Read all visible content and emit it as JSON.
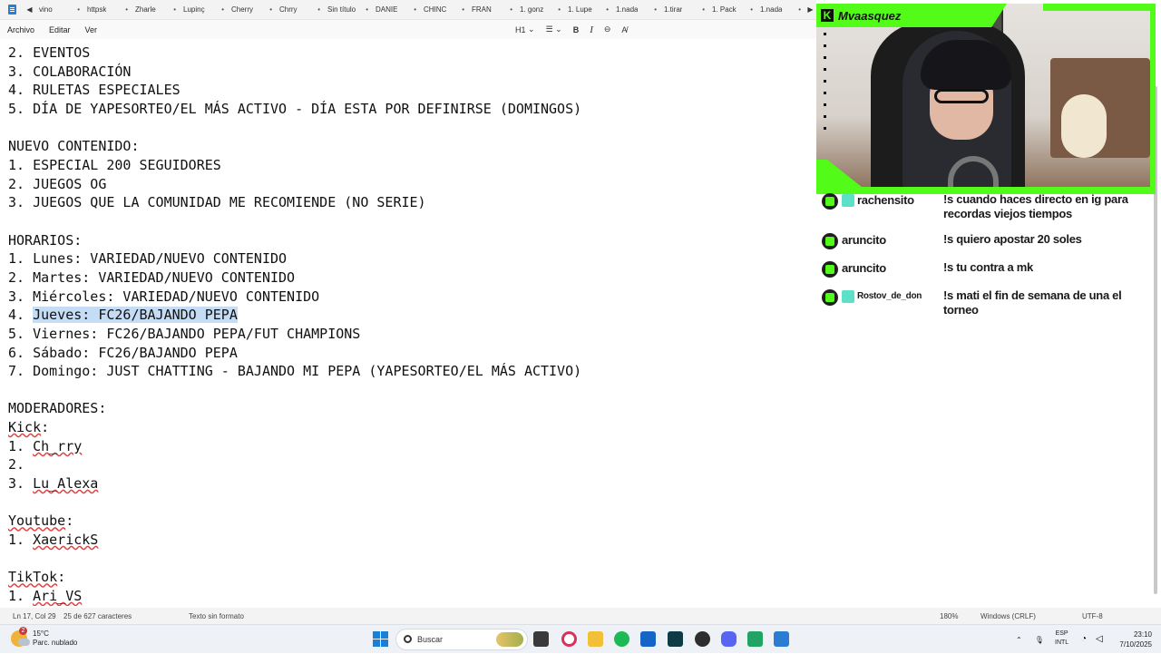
{
  "tabs": [
    "vino",
    "httpsk",
    "Zharle",
    "Lupinç",
    "Cherry",
    "Chrry",
    "Sin título",
    "DANIE",
    "CHINC",
    "FRAN",
    "1. gonz",
    "1. Lupe",
    "1.nada",
    "1.tirar",
    "1. Pack",
    "1.nada"
  ],
  "menu": {
    "file": "Archivo",
    "edit": "Editar",
    "view": "Ver"
  },
  "format": {
    "heading": "H1",
    "bold": "B",
    "italic": "I"
  },
  "document": {
    "lines": [
      "2. EVENTOS",
      "3. COLABORACIÓN",
      "4. RULETAS ESPECIALES",
      "5. DÍA DE YAPESORTEO/EL MÁS ACTIVO - DÍA ESTA POR DEFINIRSE (DOMINGOS)",
      "",
      "NUEVO CONTENIDO:",
      "1. ESPECIAL 200 SEGUIDORES",
      "2. JUEGOS OG",
      "3. JUEGOS QUE LA COMUNIDAD ME RECOMIENDE (NO SERIE)",
      "",
      "HORARIOS:",
      "1. Lunes: VARIEDAD/NUEVO CONTENIDO",
      "2. Martes: VARIEDAD/NUEVO CONTENIDO",
      "3. Miércoles: VARIEDAD/NUEVO CONTENIDO",
      "4. Jueves: FC26/BAJANDO PEPA",
      "5. Viernes: FC26/BAJANDO PEPA/FUT CHAMPIONS",
      "6. Sábado: FC26/BAJANDO PEPA",
      "7. Domingo: JUST CHATTING - BAJANDO MI PEPA (YAPESORTEO/EL MÁS ACTIVO)",
      "",
      "MODERADORES:",
      "Kick:",
      "1. Ch_rry",
      "2.",
      "3. Lu_Alexa",
      "",
      "Youtube:",
      "1. XaerickS",
      "",
      "TikTok:",
      "1. Ari_VS"
    ],
    "selected_prefix": "4. ",
    "selected_text": "Jueves: FC26/BAJANDO PEPA"
  },
  "status": {
    "position": "Ln 17, Col 29",
    "chars": "25 de 627 caracteres",
    "format": "Texto sin formato",
    "zoom": "180%",
    "eol": "Windows (CRLF)",
    "encoding": "UTF-8"
  },
  "stream": {
    "channel": "Mvaasquez"
  },
  "chat": [
    {
      "user": "rachensito",
      "text": "!s cuando haces directo en ig para recordas viejos tiempos",
      "badge": true
    },
    {
      "user": "aruncito",
      "text": "!s quiero apostar 20 soles",
      "badge": false
    },
    {
      "user": "aruncito",
      "text": "!s tu contra a mk",
      "badge": false
    },
    {
      "user": "Rostov_de_don",
      "text": "!s mati el fin de semana de una el torneo",
      "badge": true
    }
  ],
  "taskbar": {
    "temp": "15°C",
    "weather": "Parc. nublado",
    "weather_badge": "2",
    "search": "Buscar",
    "lang1": "ESP",
    "lang2": "INTL",
    "time": "23:10",
    "date": "7/10/2025"
  },
  "colors": {
    "kick_green": "#53fc18",
    "selection": "#c5dcf5"
  }
}
